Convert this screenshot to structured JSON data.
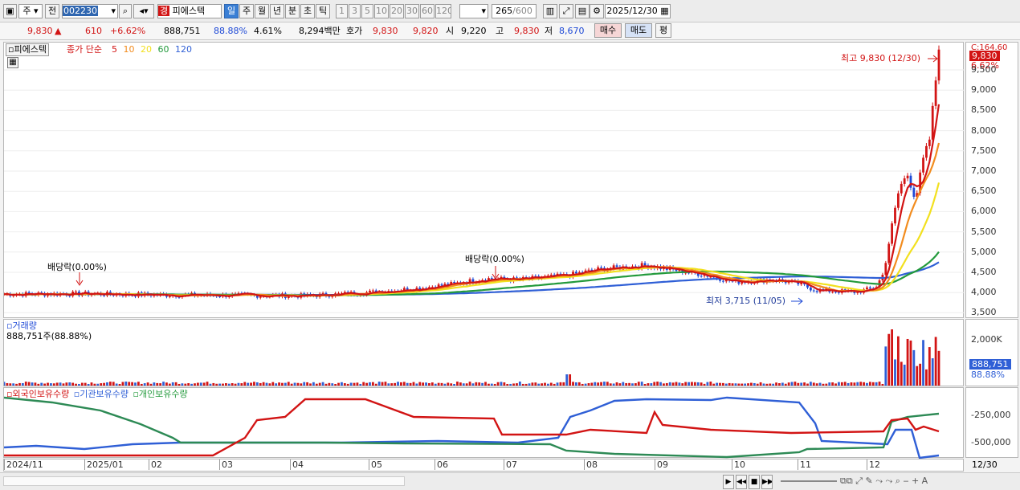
{
  "toolbar": {
    "market": "주",
    "prev": "전",
    "code": "002230",
    "stock_badge": "경",
    "stock_name": "피에스텍",
    "periods": [
      "일",
      "주",
      "월",
      "년",
      "분",
      "초",
      "틱"
    ],
    "active_period": "일",
    "minutes": [
      "1",
      "3",
      "5",
      "10",
      "20",
      "30",
      "60",
      "120"
    ],
    "count_value": "265",
    "count_max": "/600",
    "date": "2025/12/30"
  },
  "quote": {
    "price": "9,830",
    "arrow": "▲",
    "change": "610",
    "change_pct": "+6.62%",
    "volume": "888,751",
    "volume_ratio": "88.88%",
    "turnover": "4.61%",
    "amount": "8,294백만",
    "ask_label": "호가",
    "ask1": "9,830",
    "ask2": "9,820",
    "open_label": "시",
    "open": "9,220",
    "high_label": "고",
    "high": "9,830",
    "low_label": "저",
    "low": "8,670",
    "buy": "매수",
    "sell": "매도",
    "eval": "평"
  },
  "price_panel": {
    "tab": "피에스텍",
    "legend_title": "종가 단순",
    "ma": [
      {
        "label": "5",
        "color": "#d21414"
      },
      {
        "label": "10",
        "color": "#f28c1e"
      },
      {
        "label": "20",
        "color": "#f2e01e"
      },
      {
        "label": "60",
        "color": "#239a3c"
      },
      {
        "label": "120",
        "color": "#2f5fd6"
      }
    ],
    "dividend1": "배당락(0.00%)",
    "dividend2": "배당락(0.00%)",
    "high_note": "최고 9,830 (12/30)",
    "low_note": "최저 3,715 (11/05)",
    "scale_top": "C:164.60",
    "scale_price": "9,830",
    "scale_pct": "6.62%",
    "ticks": [
      "9,500",
      "9,000",
      "8,500",
      "8,000",
      "7,500",
      "7,000",
      "6,500",
      "6,000",
      "5,500",
      "5,000",
      "4,500",
      "4,000",
      "3,500"
    ]
  },
  "volume_panel": {
    "title": "거래량",
    "value": "888,751주(88.88%)",
    "tick": "2,000K",
    "badge": "888,751",
    "badge_pct": "88.88%"
  },
  "holdings_panel": {
    "legend": [
      {
        "label": "외국인보유수량",
        "color": "#d21414"
      },
      {
        "label": "기관보유수량",
        "color": "#2f5fd6"
      },
      {
        "label": "개인보유수량",
        "color": "#239a3c"
      }
    ],
    "ticks": [
      "-250,000",
      "-500,000"
    ]
  },
  "x_axis": {
    "labels": [
      "2024/11",
      "2025/01",
      "02",
      "03",
      "04",
      "05",
      "06",
      "07",
      "08",
      "09",
      "10",
      "11",
      "12"
    ],
    "right_label": "12/30"
  },
  "chart_data": {
    "type": "line",
    "title": "피에스텍",
    "y_range": [
      3500,
      9830
    ],
    "close_series": [
      {
        "x": "2024/11",
        "y": 3900
      },
      {
        "x": "2025/02",
        "y": 3880
      },
      {
        "x": "2025/05",
        "y": 3960
      },
      {
        "x": "2025/07",
        "y": 4250
      },
      {
        "x": "2025/08",
        "y": 4550
      },
      {
        "x": "2025/09",
        "y": 4700
      },
      {
        "x": "2025/10",
        "y": 4200
      },
      {
        "x": "2025/11",
        "y": 3950
      },
      {
        "x": "2025/12",
        "y": 4200
      },
      {
        "x": "2025/12/30",
        "y": 9830
      }
    ],
    "annotations": {
      "high": {
        "value": 9830,
        "date": "12/30"
      },
      "low": {
        "value": 3715,
        "date": "11/05"
      }
    },
    "volume_last": 888751
  }
}
